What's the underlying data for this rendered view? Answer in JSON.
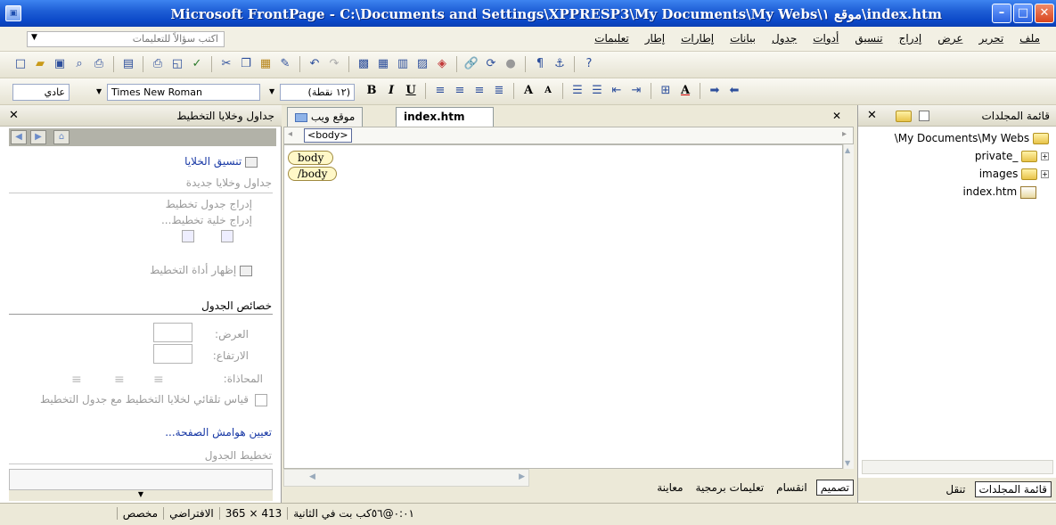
{
  "window": {
    "title": "Microsoft FrontPage - C:\\Documents and Settings\\XPPRESP3\\My Documents\\My Webs\\موقع ١\\index.htm",
    "app_icon": "frontpage-app-icon"
  },
  "menubar": {
    "items": [
      "ملف",
      "تحرير",
      "عرض",
      "إدراج",
      "تنسيق",
      "أدوات",
      "جدول",
      "بيانات",
      "إطارات",
      "إطار",
      "تعليمات"
    ],
    "help_placeholder": "اكتب سؤالاً للتعليمات"
  },
  "format_toolbar": {
    "style": "عادي",
    "font": "Times New Roman",
    "size": "(١٢ نقطة)"
  },
  "taskpane": {
    "title": "جداول وخلايا التخطيط",
    "cell_formatting_link": "تنسيق الخلايا",
    "new_tables_section": "جداول وخلايا جديدة",
    "insert_layout_table": "إدراج جدول تخطيط",
    "insert_layout_cell": "إدراج خلية تخطيط...",
    "show_layout_tool": "إظهار أداة التخطيط",
    "table_properties": "خصائص الجدول",
    "width_label": "العرض:",
    "height_label": "الارتفاع:",
    "alignment_label": "المحاذاة:",
    "autoscale_label": "قياس تلقائي لخلايا التخطيط مع جدول التخطيط",
    "set_page_margins": "تعيين هوامش الصفحة...",
    "table_layout_section": "تخطيط الجدول"
  },
  "editor": {
    "tabs": [
      "موقع ويب",
      "index.htm"
    ],
    "active_tab": "index.htm",
    "tag_selector": "<body>",
    "tag_open": "body",
    "tag_close": "/body",
    "view_tabs": [
      "تصميم",
      "انقسام",
      "تعليمات برمجية",
      "معاينة"
    ],
    "active_view": "تصميم"
  },
  "folderpane": {
    "title": "قائمة المجلدات",
    "root": "\\My Documents\\My Webs",
    "items": [
      {
        "name": "_private",
        "type": "folder",
        "expandable": true
      },
      {
        "name": "images",
        "type": "folder",
        "expandable": true
      },
      {
        "name": "index.htm",
        "type": "home-page"
      }
    ],
    "bottom_tabs": [
      "قائمة المجلدات",
      "تنقل"
    ]
  },
  "statusbar": {
    "transfer_time": "٠:٠١@٥٦كب بت في الثانية",
    "dimensions": "413 × 365",
    "default_label": "الافتراضي",
    "custom_label": "مخصص"
  }
}
